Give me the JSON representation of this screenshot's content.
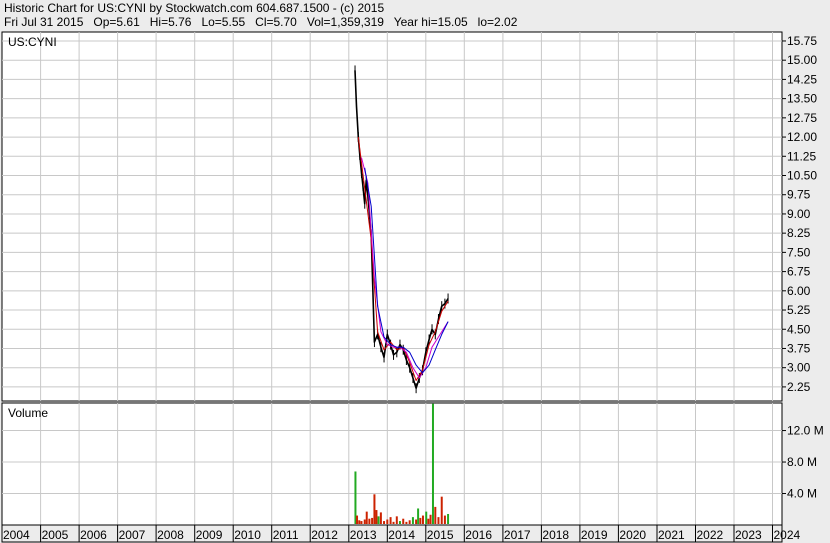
{
  "header": {
    "line1": "Historic Chart for US:CYNI by Stockwatch.com 604.687.1500 - (c) 2015",
    "line2": "Fri Jul 31 2015   Op=5.61   Hi=5.76   Lo=5.55   Cl=5.70   Vol=1,359,319   Year hi=15.05   lo=2.02"
  },
  "colors": {
    "background": "#ececec",
    "plot_bg": "#ffffff",
    "grid": "#c8c8c8",
    "price": "#000000",
    "ma_short": "#cc0000",
    "ma_mid": "#cc00cc",
    "ma_long": "#0000cc",
    "volume_up": "#22aa22",
    "volume_down": "#cc2200"
  },
  "chart_data": [
    {
      "type": "line",
      "panel": "price",
      "label": "US:CYNI",
      "x_axis": "date",
      "xlim": [
        "2004-01-01",
        "2024-03-31"
      ],
      "year_labels": [
        "2004",
        "2005",
        "2006",
        "2007",
        "2008",
        "2009",
        "2010",
        "2011",
        "2012",
        "2013",
        "2014",
        "2015",
        "2016",
        "2017",
        "2018",
        "2019",
        "2020",
        "2021",
        "2022",
        "2023",
        "2024"
      ],
      "yticks": [
        "15.75",
        "15.00",
        "14.25",
        "13.50",
        "12.75",
        "12.00",
        "11.25",
        "10.50",
        "9.75",
        "9.00",
        "8.25",
        "7.50",
        "6.75",
        "6.00",
        "5.25",
        "4.50",
        "3.75",
        "3.00",
        "2.25"
      ],
      "ylim": [
        1.7,
        16.1
      ],
      "grid": true,
      "series": [
        {
          "role": "price",
          "x": [
            "2013-03-01",
            "2013-03-15",
            "2013-04-01",
            "2013-04-15",
            "2013-05-01",
            "2013-05-15",
            "2013-06-01",
            "2013-06-15",
            "2013-07-01",
            "2013-08-01",
            "2013-09-01",
            "2013-10-01",
            "2013-11-01",
            "2013-12-01",
            "2014-01-01",
            "2014-02-01",
            "2014-03-01",
            "2014-04-01",
            "2014-05-01",
            "2014-06-01",
            "2014-07-01",
            "2014-08-01",
            "2014-09-01",
            "2014-10-01",
            "2014-11-01",
            "2014-12-01",
            "2015-01-01",
            "2015-02-01",
            "2015-03-01",
            "2015-04-01",
            "2015-05-01",
            "2015-06-01",
            "2015-07-01",
            "2015-07-31"
          ],
          "y": [
            14.6,
            13.2,
            12.0,
            11.3,
            10.6,
            10.1,
            9.4,
            10.3,
            9.7,
            8.2,
            4.0,
            4.3,
            3.8,
            3.4,
            4.3,
            3.9,
            3.5,
            3.6,
            3.9,
            3.7,
            3.3,
            3.0,
            2.6,
            2.2,
            2.6,
            2.9,
            3.6,
            4.1,
            4.5,
            4.3,
            4.9,
            5.4,
            5.5,
            5.7
          ]
        },
        {
          "role": "moving-average-short",
          "x": [
            "2013-04-01",
            "2013-06-01",
            "2013-08-01",
            "2013-10-01",
            "2013-12-01",
            "2014-02-01",
            "2014-04-01",
            "2014-06-01",
            "2014-08-01",
            "2014-10-01",
            "2014-12-01",
            "2015-02-01",
            "2015-04-01",
            "2015-06-01",
            "2015-07-31"
          ],
          "y": [
            12.0,
            10.0,
            8.0,
            4.4,
            3.7,
            4.0,
            3.7,
            3.8,
            3.2,
            2.5,
            2.9,
            3.9,
            4.4,
            5.2,
            5.6
          ]
        },
        {
          "role": "moving-average-mid",
          "x": [
            "2013-05-01",
            "2013-07-01",
            "2013-09-01",
            "2013-11-01",
            "2014-01-01",
            "2014-03-01",
            "2014-05-01",
            "2014-07-01",
            "2014-09-01",
            "2014-11-01",
            "2015-01-01",
            "2015-03-01",
            "2015-05-01",
            "2015-07-31"
          ],
          "y": [
            11.2,
            10.2,
            6.5,
            4.4,
            3.9,
            3.8,
            3.8,
            3.6,
            3.0,
            2.6,
            3.0,
            3.8,
            4.2,
            4.8
          ]
        },
        {
          "role": "moving-average-long",
          "x": [
            "2013-06-01",
            "2013-08-01",
            "2013-10-01",
            "2013-12-01",
            "2014-02-01",
            "2014-04-01",
            "2014-06-01",
            "2014-08-01",
            "2014-10-01",
            "2014-12-01",
            "2015-02-01",
            "2015-04-01",
            "2015-06-01",
            "2015-07-31"
          ],
          "y": [
            10.8,
            9.3,
            5.4,
            4.2,
            3.9,
            3.8,
            3.8,
            3.6,
            3.1,
            2.8,
            3.1,
            3.7,
            4.3,
            4.8
          ]
        }
      ]
    },
    {
      "type": "bar",
      "panel": "volume",
      "label": "Volume",
      "x_axis": "date",
      "yticks": [
        "12.0 M",
        "8.0 M",
        "4.0 M"
      ],
      "ytick_values": [
        12.0,
        8.0,
        4.0
      ],
      "ylim": [
        0,
        15.5
      ],
      "units": "M",
      "series": [
        {
          "x": [
            "2013-03-05",
            "2013-03-20",
            "2013-04-10",
            "2013-05-01",
            "2013-06-01",
            "2013-06-20",
            "2013-07-15",
            "2013-08-10",
            "2013-09-01",
            "2013-09-20",
            "2013-10-10",
            "2013-11-01",
            "2013-12-01",
            "2014-01-01",
            "2014-02-01",
            "2014-03-01",
            "2014-04-01",
            "2014-05-01",
            "2014-06-01",
            "2014-07-01",
            "2014-08-01",
            "2014-09-01",
            "2014-10-01",
            "2014-10-20",
            "2014-11-10",
            "2014-12-05",
            "2015-01-05",
            "2015-01-25",
            "2015-02-15",
            "2015-03-10",
            "2015-04-01",
            "2015-05-01",
            "2015-06-01",
            "2015-07-01",
            "2015-07-31"
          ],
          "y": [
            6.8,
            1.2,
            0.6,
            0.5,
            0.7,
            1.7,
            0.8,
            0.9,
            3.9,
            1.9,
            1.1,
            1.6,
            0.5,
            0.7,
            1.0,
            0.4,
            1.1,
            0.5,
            0.8,
            0.4,
            0.6,
            1.0,
            0.7,
            2.1,
            0.9,
            1.2,
            1.7,
            0.8,
            1.3,
            15.4,
            2.3,
            1.0,
            3.6,
            1.2,
            1.4
          ],
          "direction": [
            "up",
            "down",
            "down",
            "down",
            "down",
            "down",
            "down",
            "down",
            "down",
            "down",
            "up",
            "down",
            "down",
            "down",
            "down",
            "down",
            "down",
            "up",
            "down",
            "down",
            "down",
            "up",
            "down",
            "up",
            "down",
            "down",
            "up",
            "down",
            "down",
            "up",
            "down",
            "down",
            "down",
            "down",
            "up"
          ]
        }
      ]
    }
  ]
}
